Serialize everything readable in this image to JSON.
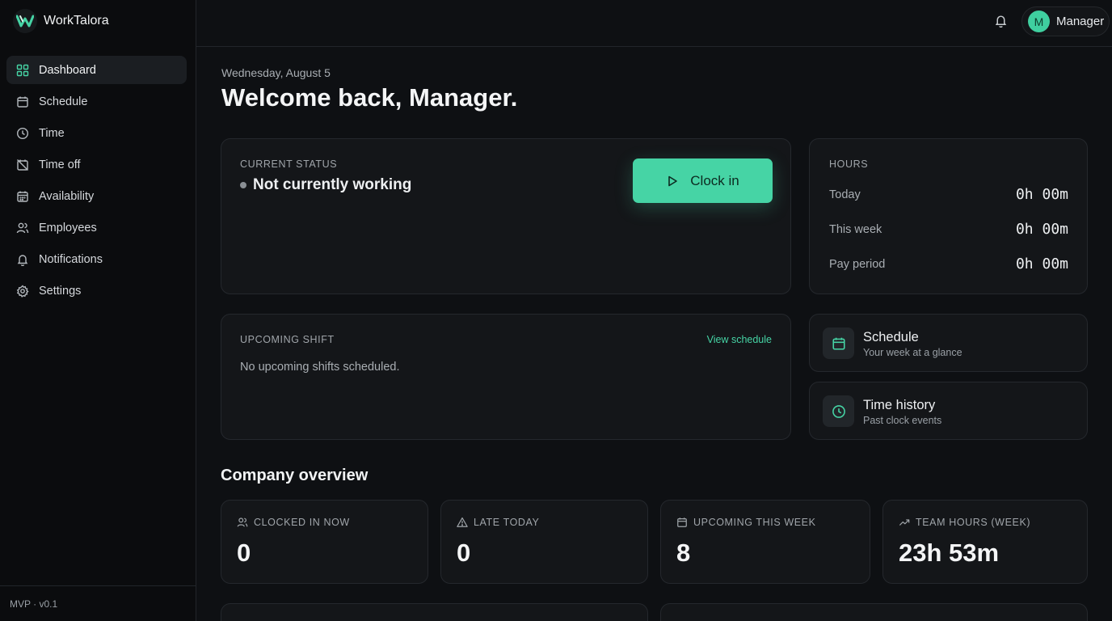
{
  "app": {
    "name": "WorkTalora",
    "logo_icon": "worktalora-logo-icon",
    "version": "MVP · v0.1"
  },
  "colors": {
    "accent": "#46d4a5",
    "background": "#0e1013",
    "card": "#141619"
  },
  "sidebar": {
    "items": [
      {
        "label": "Dashboard",
        "icon": "grid-icon",
        "active": true
      },
      {
        "label": "Schedule",
        "icon": "calendar-icon"
      },
      {
        "label": "Time",
        "icon": "clock-icon"
      },
      {
        "label": "Time off",
        "icon": "calendar-off-icon"
      },
      {
        "label": "Availability",
        "icon": "calendar-grid-icon"
      },
      {
        "label": "Employees",
        "icon": "users-icon"
      },
      {
        "label": "Notifications",
        "icon": "bell-icon"
      },
      {
        "label": "Settings",
        "icon": "gear-icon"
      }
    ]
  },
  "header": {
    "user": {
      "initial": "M",
      "name": "Manager"
    },
    "notification_icon": "bell-icon"
  },
  "main": {
    "date": "Wednesday, August 5",
    "welcome": "Welcome back, Manager.",
    "status": {
      "label": "CURRENT STATUS",
      "text": "Not currently working",
      "button": "Clock in"
    },
    "hours": {
      "label": "HOURS",
      "rows": [
        {
          "label": "Today",
          "value": "0h 00m"
        },
        {
          "label": "This week",
          "value": "0h 00m"
        },
        {
          "label": "Pay period",
          "value": "0h 00m"
        }
      ]
    },
    "upcoming": {
      "label": "UPCOMING SHIFT",
      "link": "View schedule",
      "empty": "No upcoming shifts scheduled."
    },
    "links": [
      {
        "title": "Schedule",
        "subtitle": "Your week at a glance",
        "icon": "calendar-icon"
      },
      {
        "title": "Time history",
        "subtitle": "Past clock events",
        "icon": "clock-icon"
      }
    ],
    "overview": {
      "title": "Company overview",
      "stats": [
        {
          "label": "CLOCKED IN NOW",
          "value": "0",
          "icon": "users-icon"
        },
        {
          "label": "LATE TODAY",
          "value": "0",
          "icon": "alert-triangle-icon"
        },
        {
          "label": "UPCOMING THIS WEEK",
          "value": "8",
          "icon": "calendar-icon"
        },
        {
          "label": "TEAM HOURS (WEEK)",
          "value": "23h 53m",
          "icon": "trending-up-icon"
        }
      ]
    }
  }
}
